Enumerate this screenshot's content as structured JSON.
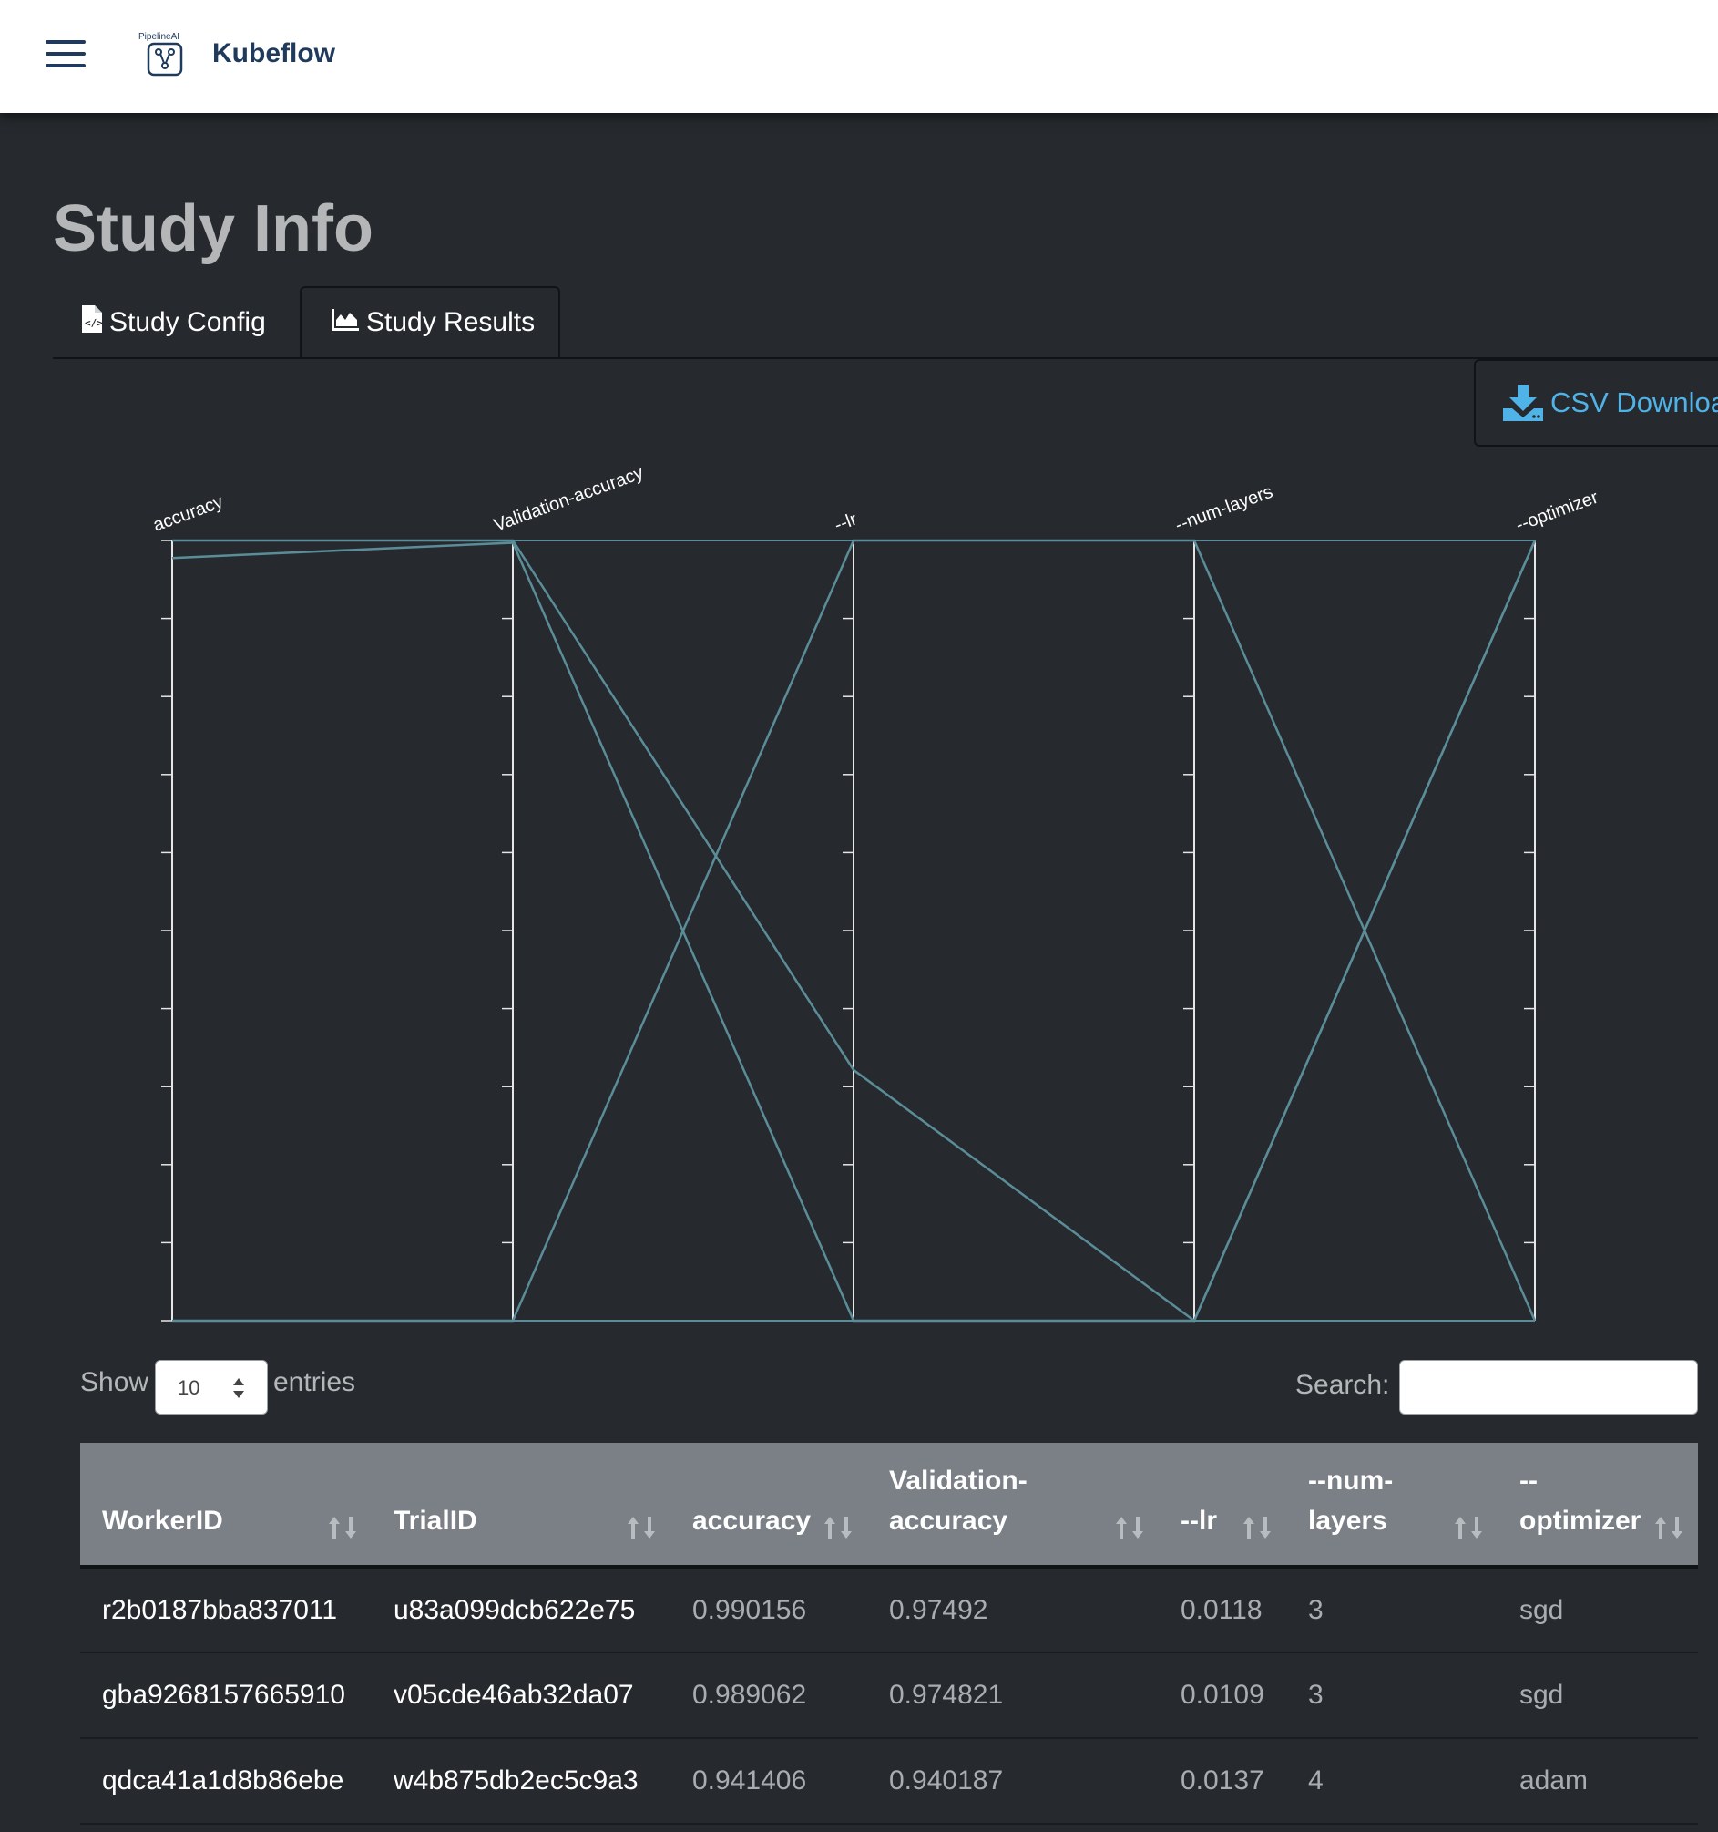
{
  "app": {
    "brand_small": "PipelineAI",
    "brand": "Kubeflow"
  },
  "page": {
    "title": "Study Info"
  },
  "tabs": [
    {
      "label": "Study Config",
      "icon": "file-code-icon"
    },
    {
      "label": "Study Results",
      "icon": "area-chart-icon"
    }
  ],
  "actions": {
    "csv_label": "CSV Download",
    "csv_icon": "download-icon",
    "csv_color": "#4fb3e8"
  },
  "table_controls": {
    "show_label": "Show",
    "page_length": "10",
    "entries_label": "entries",
    "search_label": "Search:"
  },
  "table": {
    "columns": [
      {
        "lines": [
          "WorkerID"
        ]
      },
      {
        "lines": [
          "TrialID"
        ]
      },
      {
        "lines": [
          "accuracy"
        ]
      },
      {
        "lines": [
          "Validation-",
          "accuracy"
        ]
      },
      {
        "lines": [
          "--lr"
        ]
      },
      {
        "lines": [
          "--num-",
          "layers"
        ]
      },
      {
        "lines": [
          "--",
          "optimizer"
        ]
      }
    ],
    "rows": [
      [
        "r2b0187bba837011",
        "u83a099dcb622e75",
        "0.990156",
        "0.97492",
        "0.0118",
        "3",
        "sgd"
      ],
      [
        "gba9268157665910",
        "v05cde46ab32da07",
        "0.989062",
        "0.974821",
        "0.0109",
        "3",
        "sgd"
      ],
      [
        "qdca41a1d8b86ebe",
        "w4b875db2ec5c9a3",
        "0.941406",
        "0.940187",
        "0.0137",
        "4",
        "adam"
      ]
    ]
  },
  "chart_data": {
    "type": "parallel-coordinates",
    "axes": [
      "accuracy",
      "Validation-accuracy",
      "--lr",
      "--num-layers",
      "--optimizer"
    ],
    "series": [
      {
        "values": [
          0.990156,
          0.97492,
          0.0118,
          3,
          "sgd"
        ]
      },
      {
        "values": [
          0.989062,
          0.974821,
          0.0109,
          3,
          "sgd"
        ]
      },
      {
        "values": [
          0.941406,
          0.940187,
          0.0137,
          4,
          "adam"
        ]
      }
    ],
    "line_color": "#5b8d99"
  }
}
